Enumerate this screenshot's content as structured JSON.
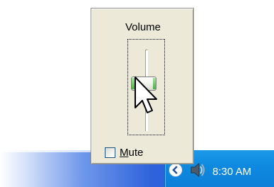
{
  "volume_popup": {
    "title": "Volume",
    "slider_level": 0.6,
    "mute": {
      "label_accel": "M",
      "label_rest": "ute",
      "checked": false
    }
  },
  "taskbar": {
    "clock": "8:30 AM",
    "tray_icons": [
      "chevron-left-icon",
      "speaker-icon"
    ]
  },
  "colors": {
    "popup_bg": "#ece9d8",
    "taskbar_blue": "#245edb",
    "tray_blue": "#0e8ae0",
    "thumb_green": "#4bb041"
  }
}
